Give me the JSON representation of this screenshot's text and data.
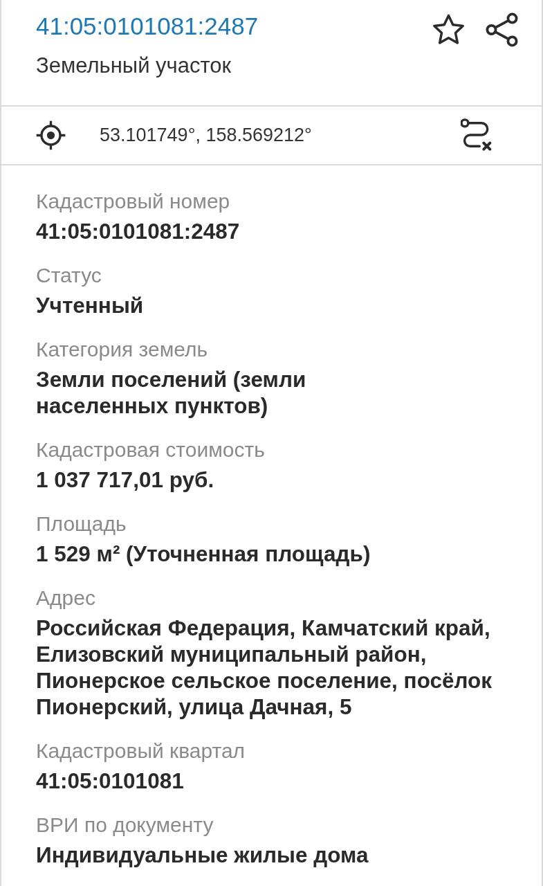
{
  "header": {
    "title": "41:05:0101081:2487",
    "subtitle": "Земельный участок",
    "starred": false
  },
  "location": {
    "coordinates": "53.101749°, 158.569212°"
  },
  "fields": [
    {
      "label": "Кадастровый номер",
      "value": "41:05:0101081:2487"
    },
    {
      "label": "Статус",
      "value": "Учтенный"
    },
    {
      "label": "Категория земель",
      "value": "Земли поселений (земли\nнаселенных пунктов)"
    },
    {
      "label": "Кадастровая стоимость",
      "value": "1 037 717,01 руб."
    },
    {
      "label": "Площадь",
      "value": "1 529 м² (Уточненная площадь)"
    },
    {
      "label": "Адрес",
      "value": "Российская Федерация, Камчатский край, Елизовский муниципальный район, Пионерское сельское поселение, посёлок Пионерский, улица Дачная, 5"
    },
    {
      "label": "Кадастровый квартал",
      "value": "41:05:0101081"
    },
    {
      "label": "ВРИ по документу",
      "value": "Индивидуальные жилые дома"
    }
  ]
}
